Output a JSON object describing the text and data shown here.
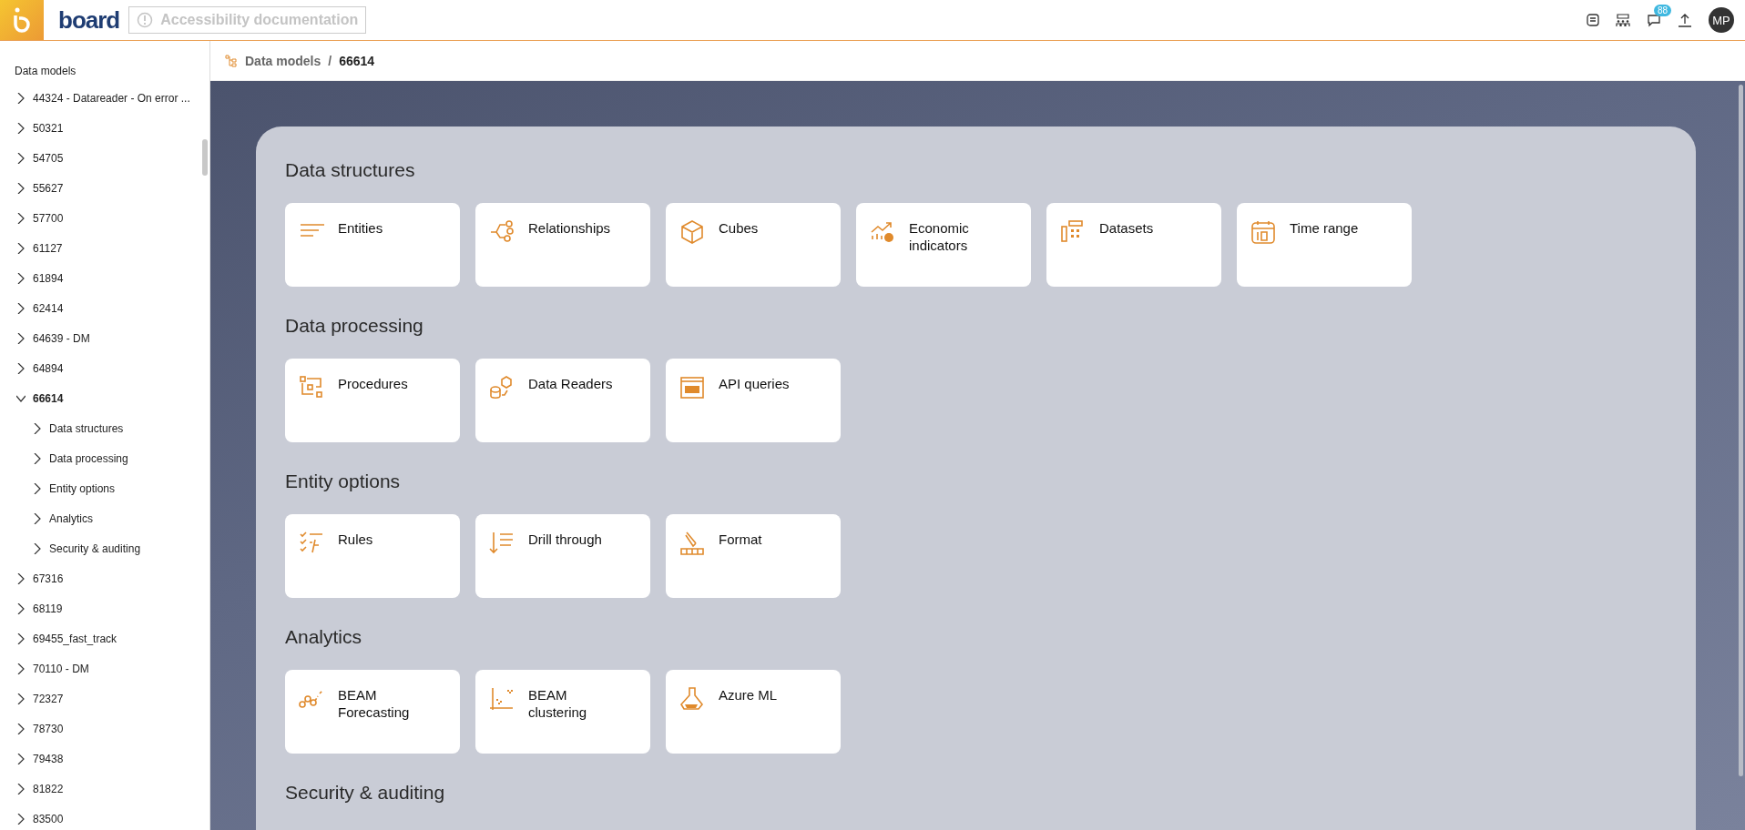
{
  "topbar": {
    "logo_text": "board",
    "doc_button": {
      "label": "Accessibility documentation",
      "disabled": true
    },
    "notification_count": "88",
    "avatar": "MP"
  },
  "sidebar": {
    "title": "Data models",
    "items": [
      {
        "label": "44324 - Datareader - On error ...",
        "selected": false,
        "expanded": false
      },
      {
        "label": "50321",
        "selected": false,
        "expanded": false
      },
      {
        "label": "54705",
        "selected": false,
        "expanded": false
      },
      {
        "label": "55627",
        "selected": false,
        "expanded": false
      },
      {
        "label": "57700",
        "selected": false,
        "expanded": false
      },
      {
        "label": "61127",
        "selected": false,
        "expanded": false
      },
      {
        "label": "61894",
        "selected": false,
        "expanded": false
      },
      {
        "label": "62414",
        "selected": false,
        "expanded": false
      },
      {
        "label": "64639 - DM",
        "selected": false,
        "expanded": false
      },
      {
        "label": "64894",
        "selected": false,
        "expanded": false
      },
      {
        "label": "66614",
        "selected": true,
        "expanded": true,
        "children": [
          {
            "label": "Data structures",
            "selected": false,
            "expanded": false
          },
          {
            "label": "Data processing",
            "selected": false,
            "expanded": false
          },
          {
            "label": "Entity options",
            "selected": false,
            "expanded": false
          },
          {
            "label": "Analytics",
            "selected": false,
            "expanded": false
          },
          {
            "label": "Security & auditing",
            "selected": false,
            "expanded": false
          }
        ]
      },
      {
        "label": "67316",
        "selected": false,
        "expanded": false
      },
      {
        "label": "68119",
        "selected": false,
        "expanded": false
      },
      {
        "label": "69455_fast_track",
        "selected": false,
        "expanded": false
      },
      {
        "label": "70110 - DM",
        "selected": false,
        "expanded": false
      },
      {
        "label": "72327",
        "selected": false,
        "expanded": false
      },
      {
        "label": "78730",
        "selected": false,
        "expanded": false
      },
      {
        "label": "79438",
        "selected": false,
        "expanded": false
      },
      {
        "label": "81822",
        "selected": false,
        "expanded": false
      },
      {
        "label": "83500",
        "selected": false,
        "expanded": false
      }
    ]
  },
  "breadcrumb": {
    "parent": "Data models",
    "separator": "/",
    "current": "66614"
  },
  "sections": [
    {
      "title": "Data structures",
      "cards": [
        "Entities",
        "Relationships",
        "Cubes",
        "Economic indicators",
        "Datasets",
        "Time range"
      ]
    },
    {
      "title": "Data processing",
      "cards": [
        "Procedures",
        "Data Readers",
        "API queries"
      ]
    },
    {
      "title": "Entity options",
      "cards": [
        "Rules",
        "Drill through",
        "Format"
      ]
    },
    {
      "title": "Analytics",
      "cards": [
        "BEAM Forecasting",
        "BEAM clustering",
        "Azure ML"
      ]
    },
    {
      "title": "Security & auditing"
    }
  ]
}
